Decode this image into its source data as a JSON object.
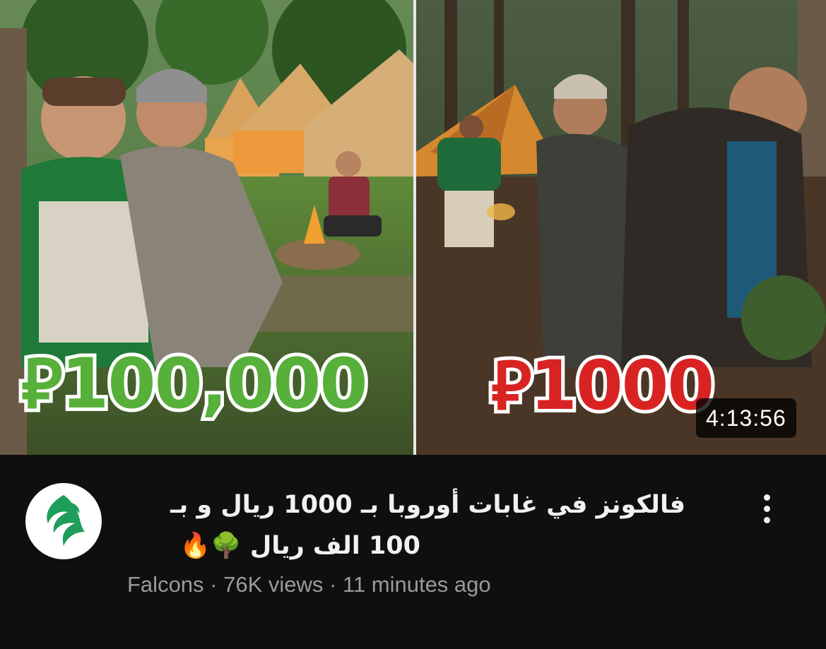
{
  "thumbnail": {
    "left_price": "⃁100,000",
    "right_price": "⃁1000",
    "duration": "4:13:56"
  },
  "video": {
    "title_line1": "فالكونز في غابات أوروبا بـ 1000 ريال و بـ",
    "title_line2": "100 الف ريال 🌳🔥",
    "channel": "Falcons",
    "separator1": " · ",
    "views": "76K views",
    "separator2": " · ",
    "age": "11 minutes ago"
  },
  "icons": {
    "avatar": "falcons-logo",
    "menu": "more-vert-icon"
  },
  "colors": {
    "background": "#0f0f0f",
    "meta_text": "#9a9a9a",
    "left_price": "#56b03a",
    "right_price": "#d92323",
    "logo_green": "#1e9e5a"
  }
}
